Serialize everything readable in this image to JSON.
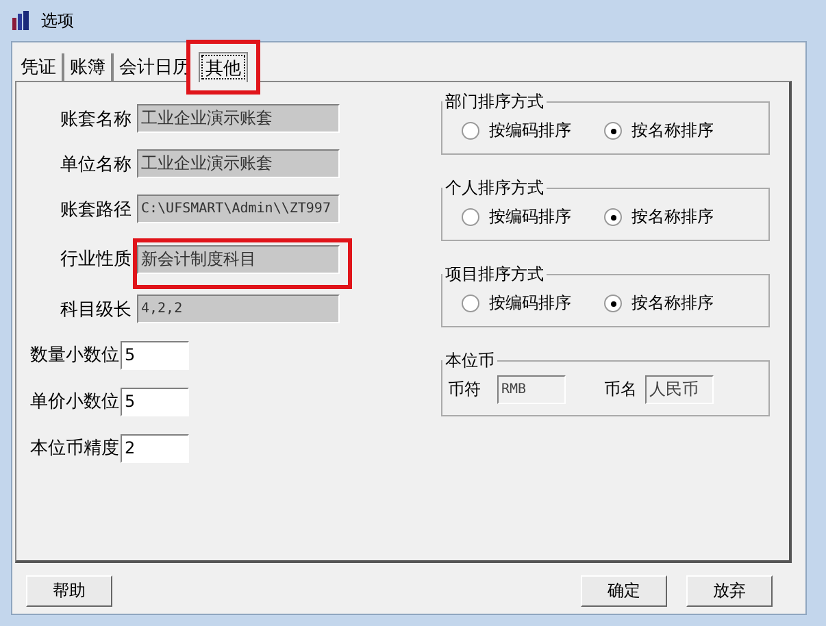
{
  "window": {
    "title": "选项"
  },
  "tabs": [
    {
      "label": "凭证",
      "selected": false,
      "highlighted": false
    },
    {
      "label": "账簿",
      "selected": false,
      "highlighted": false
    },
    {
      "label": "会计日历",
      "selected": false,
      "highlighted": false
    },
    {
      "label": "其他",
      "selected": true,
      "highlighted": true
    }
  ],
  "fields": [
    {
      "label": "账套名称",
      "value": "工业企业演示账套",
      "kind": "readonly",
      "highlighted": false
    },
    {
      "label": "单位名称",
      "value": "工业企业演示账套",
      "kind": "readonly",
      "highlighted": false
    },
    {
      "label": "账套路径",
      "value": "C:\\UFSMART\\Admin\\\\ZT997",
      "kind": "readonly",
      "highlighted": false
    },
    {
      "label": "行业性质",
      "value": "新会计制度科目",
      "kind": "readonly",
      "highlighted": true
    },
    {
      "label": "科目级长",
      "value": "4,2,2",
      "kind": "readonly",
      "highlighted": false
    },
    {
      "label": "数量小数位",
      "value": "5",
      "kind": "editable",
      "highlighted": false
    },
    {
      "label": "单价小数位",
      "value": "5",
      "kind": "editable",
      "highlighted": false
    },
    {
      "label": "本位币精度",
      "value": "2",
      "kind": "editable",
      "highlighted": false
    }
  ],
  "sort_groups": [
    {
      "title": "部门排序方式",
      "options": [
        {
          "label": "按编码排序",
          "selected": false
        },
        {
          "label": "按名称排序",
          "selected": true
        }
      ]
    },
    {
      "title": "个人排序方式",
      "options": [
        {
          "label": "按编码排序",
          "selected": false
        },
        {
          "label": "按名称排序",
          "selected": true
        }
      ]
    },
    {
      "title": "项目排序方式",
      "options": [
        {
          "label": "按编码排序",
          "selected": false
        },
        {
          "label": "按名称排序",
          "selected": true
        }
      ]
    }
  ],
  "currency": {
    "title": "本位币",
    "symbol_label": "币符",
    "symbol": "RMB",
    "name_label": "币名",
    "name": "人民币"
  },
  "buttons": {
    "left": [
      "帮助"
    ],
    "right": [
      "确定",
      "放弃"
    ]
  }
}
